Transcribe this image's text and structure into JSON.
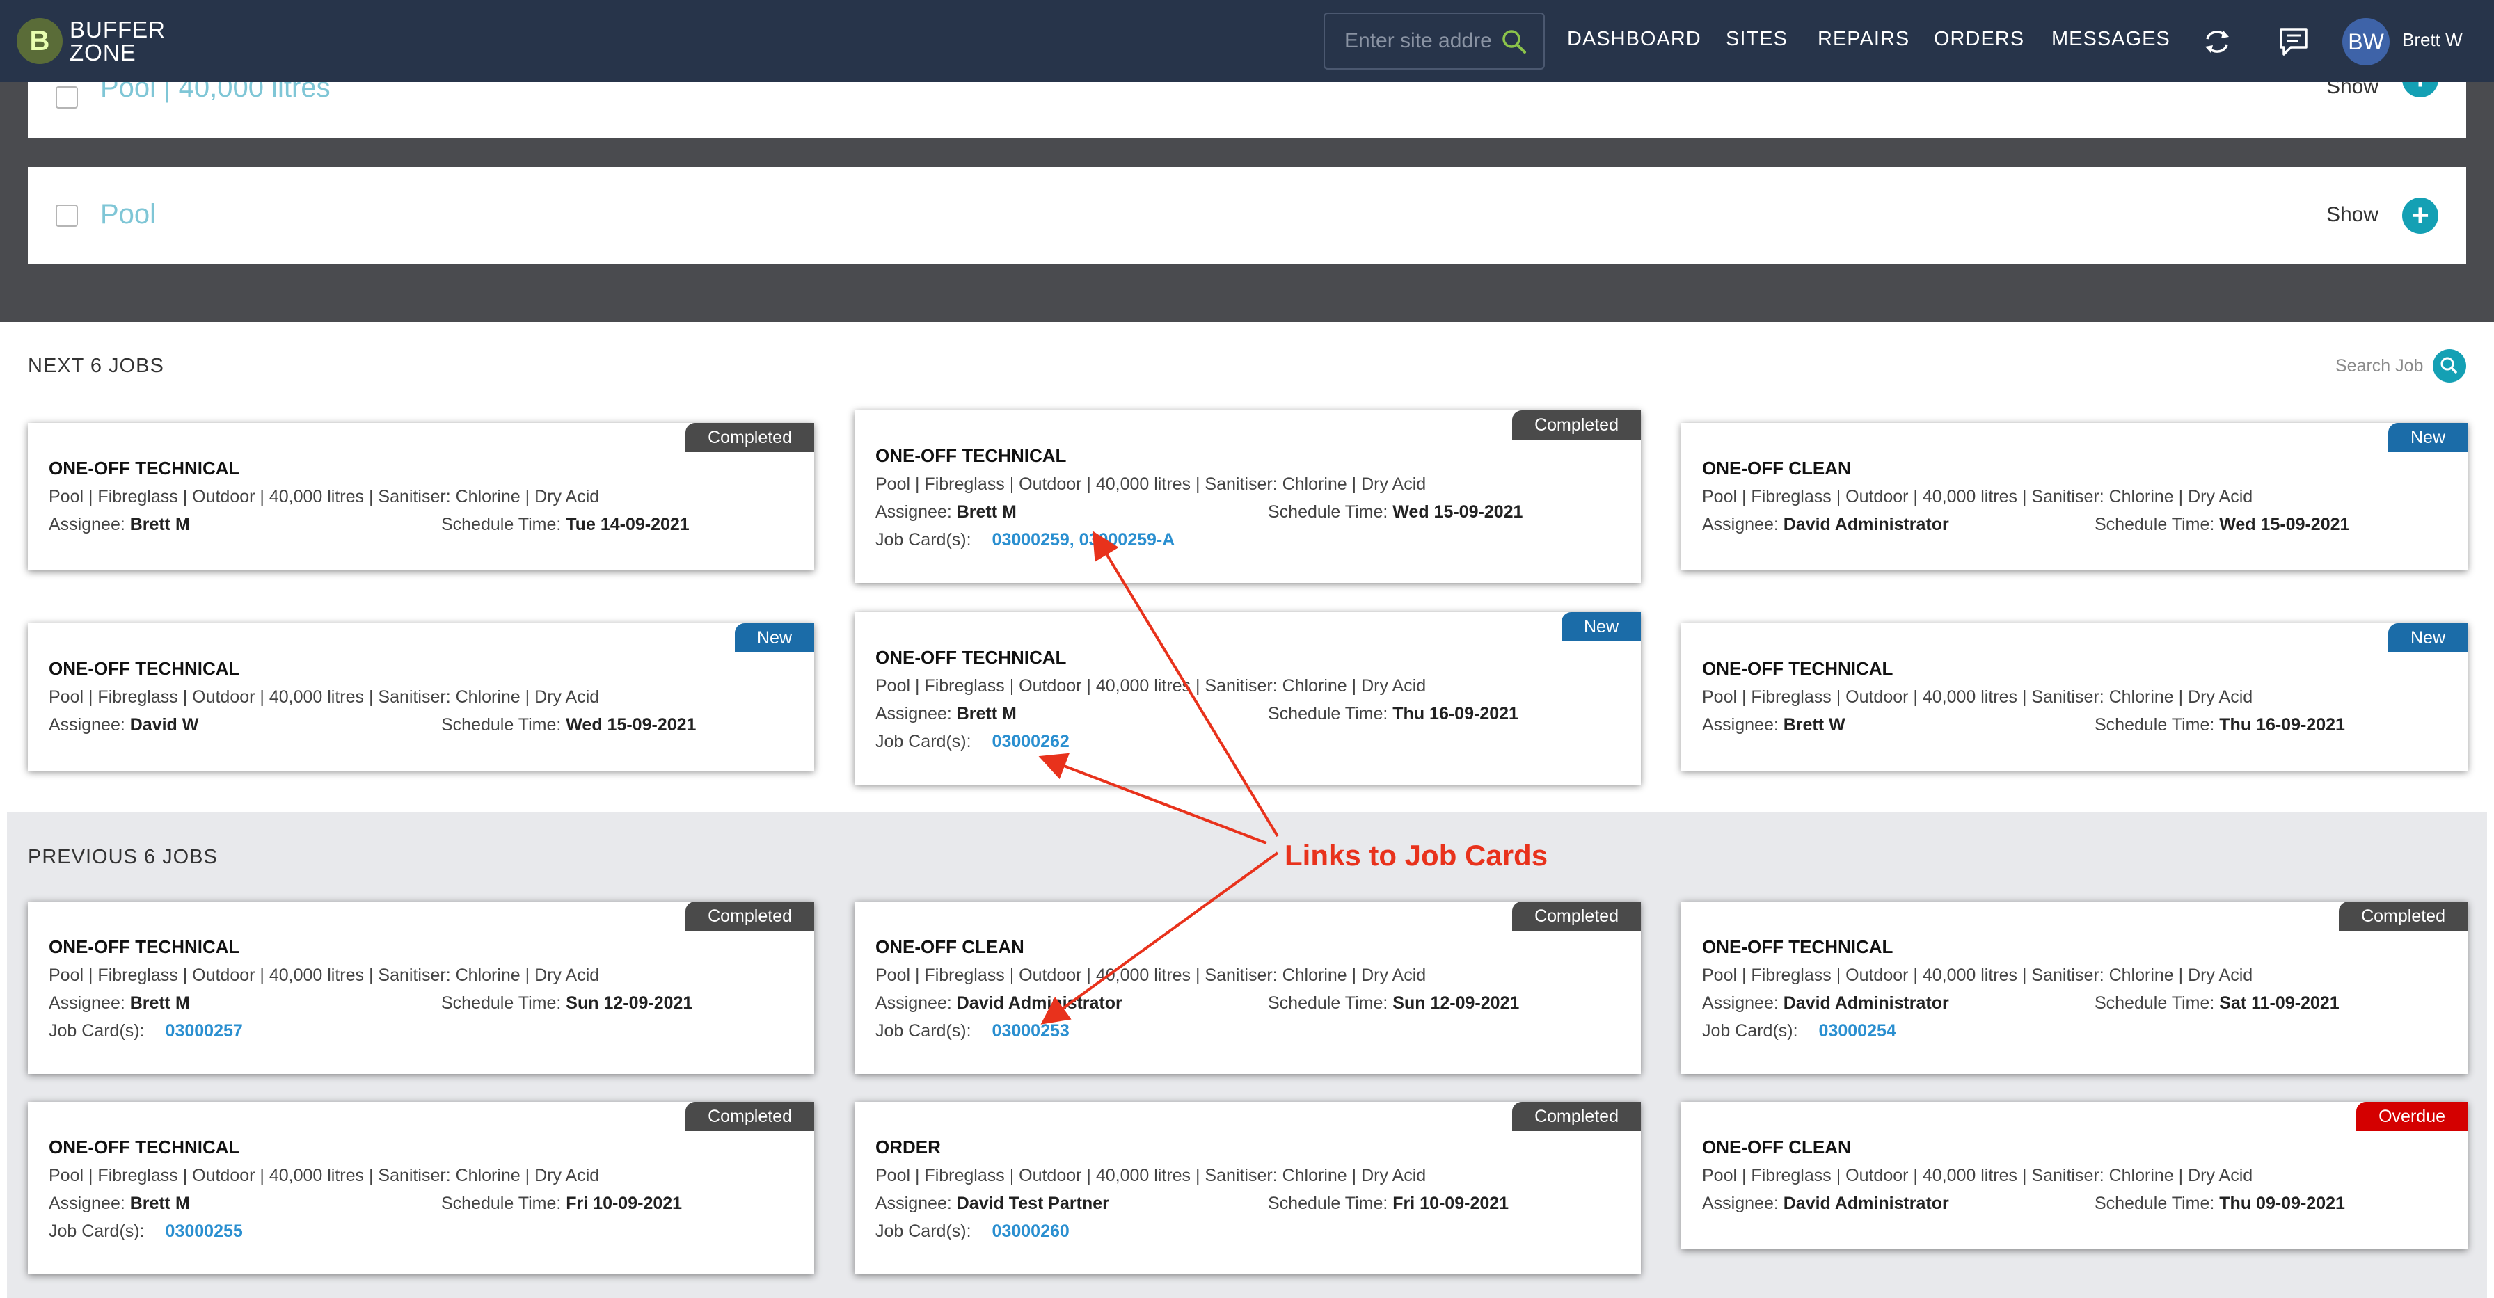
{
  "brand": {
    "logo_letter": "B",
    "line1": "BUFFER",
    "line2": "ZONE"
  },
  "header": {
    "search_placeholder": "Enter site addre",
    "nav": [
      "DASHBOARD",
      "SITES",
      "REPAIRS",
      "ORDERS",
      "MESSAGES"
    ],
    "avatar_initials": "BW",
    "user_name": "Brett W"
  },
  "pool_panels": [
    {
      "title": "Pool | 40,000 litres",
      "show_label": "Show"
    },
    {
      "title": "Pool",
      "show_label": "Show"
    }
  ],
  "next_section": {
    "title": "NEXT 6 JOBS",
    "search_label": "Search Job",
    "jobs": [
      {
        "status": "Completed",
        "title": "ONE-OFF TECHNICAL",
        "details": "Pool | Fibreglass | Outdoor | 40,000 litres | Sanitiser: Chlorine | Dry Acid",
        "assignee_label": "Assignee:",
        "assignee": "Brett M",
        "schedule_label": "Schedule Time:",
        "schedule": "Tue 14-09-2021",
        "job_cards_label": "",
        "job_cards": ""
      },
      {
        "status": "Completed",
        "title": "ONE-OFF TECHNICAL",
        "details": "Pool | Fibreglass | Outdoor | 40,000 litres | Sanitiser: Chlorine | Dry Acid",
        "assignee_label": "Assignee:",
        "assignee": "Brett M",
        "schedule_label": "Schedule Time:",
        "schedule": "Wed 15-09-2021",
        "job_cards_label": "Job Card(s):",
        "job_cards": "03000259, 03000259-A"
      },
      {
        "status": "New",
        "title": "ONE-OFF CLEAN",
        "details": "Pool | Fibreglass | Outdoor | 40,000 litres | Sanitiser: Chlorine | Dry Acid",
        "assignee_label": "Assignee:",
        "assignee": "David Administrator",
        "schedule_label": "Schedule Time:",
        "schedule": "Wed 15-09-2021",
        "job_cards_label": "",
        "job_cards": ""
      },
      {
        "status": "New",
        "title": "ONE-OFF TECHNICAL",
        "details": "Pool | Fibreglass | Outdoor | 40,000 litres | Sanitiser: Chlorine | Dry Acid",
        "assignee_label": "Assignee:",
        "assignee": "David W",
        "schedule_label": "Schedule Time:",
        "schedule": "Wed 15-09-2021",
        "job_cards_label": "",
        "job_cards": ""
      },
      {
        "status": "New",
        "title": "ONE-OFF TECHNICAL",
        "details": "Pool | Fibreglass | Outdoor | 40,000 litres | Sanitiser: Chlorine | Dry Acid",
        "assignee_label": "Assignee:",
        "assignee": "Brett M",
        "schedule_label": "Schedule Time:",
        "schedule": "Thu 16-09-2021",
        "job_cards_label": "Job Card(s):",
        "job_cards": "03000262"
      },
      {
        "status": "New",
        "title": "ONE-OFF TECHNICAL",
        "details": "Pool | Fibreglass | Outdoor | 40,000 litres | Sanitiser: Chlorine | Dry Acid",
        "assignee_label": "Assignee:",
        "assignee": "Brett W",
        "schedule_label": "Schedule Time:",
        "schedule": "Thu 16-09-2021",
        "job_cards_label": "",
        "job_cards": ""
      }
    ]
  },
  "previous_section": {
    "title": "PREVIOUS 6 JOBS",
    "jobs": [
      {
        "status": "Completed",
        "title": "ONE-OFF TECHNICAL",
        "details": "Pool | Fibreglass | Outdoor | 40,000 litres | Sanitiser: Chlorine | Dry Acid",
        "assignee_label": "Assignee:",
        "assignee": "Brett M",
        "schedule_label": "Schedule Time:",
        "schedule": "Sun 12-09-2021",
        "job_cards_label": "Job Card(s):",
        "job_cards": "03000257"
      },
      {
        "status": "Completed",
        "title": "ONE-OFF CLEAN",
        "details": "Pool | Fibreglass | Outdoor | 40,000 litres | Sanitiser: Chlorine | Dry Acid",
        "assignee_label": "Assignee:",
        "assignee": "David Administrator",
        "schedule_label": "Schedule Time:",
        "schedule": "Sun 12-09-2021",
        "job_cards_label": "Job Card(s):",
        "job_cards": "03000253"
      },
      {
        "status": "Completed",
        "title": "ONE-OFF TECHNICAL",
        "details": "Pool | Fibreglass | Outdoor | 40,000 litres | Sanitiser: Chlorine | Dry Acid",
        "assignee_label": "Assignee:",
        "assignee": "David Administrator",
        "schedule_label": "Schedule Time:",
        "schedule": "Sat 11-09-2021",
        "job_cards_label": "Job Card(s):",
        "job_cards": "03000254"
      },
      {
        "status": "Completed",
        "title": "ONE-OFF TECHNICAL",
        "details": "Pool | Fibreglass | Outdoor | 40,000 litres | Sanitiser: Chlorine | Dry Acid",
        "assignee_label": "Assignee:",
        "assignee": "Brett M",
        "schedule_label": "Schedule Time:",
        "schedule": "Fri 10-09-2021",
        "job_cards_label": "Job Card(s):",
        "job_cards": "03000255"
      },
      {
        "status": "Completed",
        "title": "ORDER",
        "details": "Pool | Fibreglass | Outdoor | 40,000 litres | Sanitiser: Chlorine | Dry Acid",
        "assignee_label": "Assignee:",
        "assignee": "David Test Partner",
        "schedule_label": "Schedule Time:",
        "schedule": "Fri 10-09-2021",
        "job_cards_label": "Job Card(s):",
        "job_cards": "03000260"
      },
      {
        "status": "Overdue",
        "title": "ONE-OFF CLEAN",
        "details": "Pool | Fibreglass | Outdoor | 40,000 litres | Sanitiser: Chlorine | Dry Acid",
        "assignee_label": "Assignee:",
        "assignee": "David Administrator",
        "schedule_label": "Schedule Time:",
        "schedule": "Thu 09-09-2021",
        "job_cards_label": "",
        "job_cards": ""
      }
    ]
  },
  "annotation": {
    "text": "Links to Job Cards",
    "color": "#e8321c"
  },
  "colors": {
    "navbar": "#27344a",
    "accent": "#14a0b4",
    "link": "#2a8fd0",
    "completed": "#4a4a4a",
    "new": "#1b6ca8",
    "overdue": "#d40000"
  }
}
